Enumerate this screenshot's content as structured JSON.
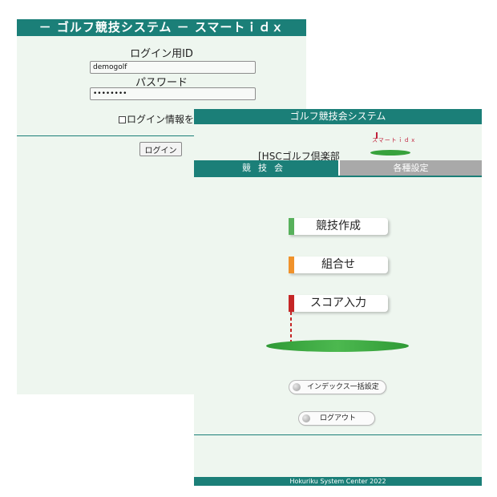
{
  "colors": {
    "accent": "#1b7f78",
    "background": "#eef6ef",
    "tab_inactive": "#a9a9a9",
    "create_bar": "#58b15c",
    "pairing_bar": "#f0922b",
    "score_bar": "#c52626"
  },
  "login": {
    "header_title": "－ ゴルフ競技システム －  スマートｉｄｘ",
    "id_label": "ログイン用ID",
    "id_value": "demogolf",
    "password_label": "パスワード",
    "password_value": "••••••••",
    "remember_label": "ログイン情報を",
    "login_button": "ログイン"
  },
  "menu": {
    "header_title": "ゴルフ競技会システム",
    "club_name": "[HSCゴルフ倶楽部",
    "logo_text": "スマートｉｄｘ",
    "tabs": [
      {
        "label": "競技会"
      },
      {
        "label": "各種設定"
      }
    ],
    "buttons": [
      {
        "label": "競技作成",
        "icon": "green-bar"
      },
      {
        "label": "組合せ",
        "icon": "orange-bar"
      },
      {
        "label": "スコア入力",
        "icon": "red-bar"
      }
    ],
    "index_button": "インデックス一括設定",
    "logout_button": "ログアウト",
    "footer": "Hokuriku System Center 2022"
  }
}
